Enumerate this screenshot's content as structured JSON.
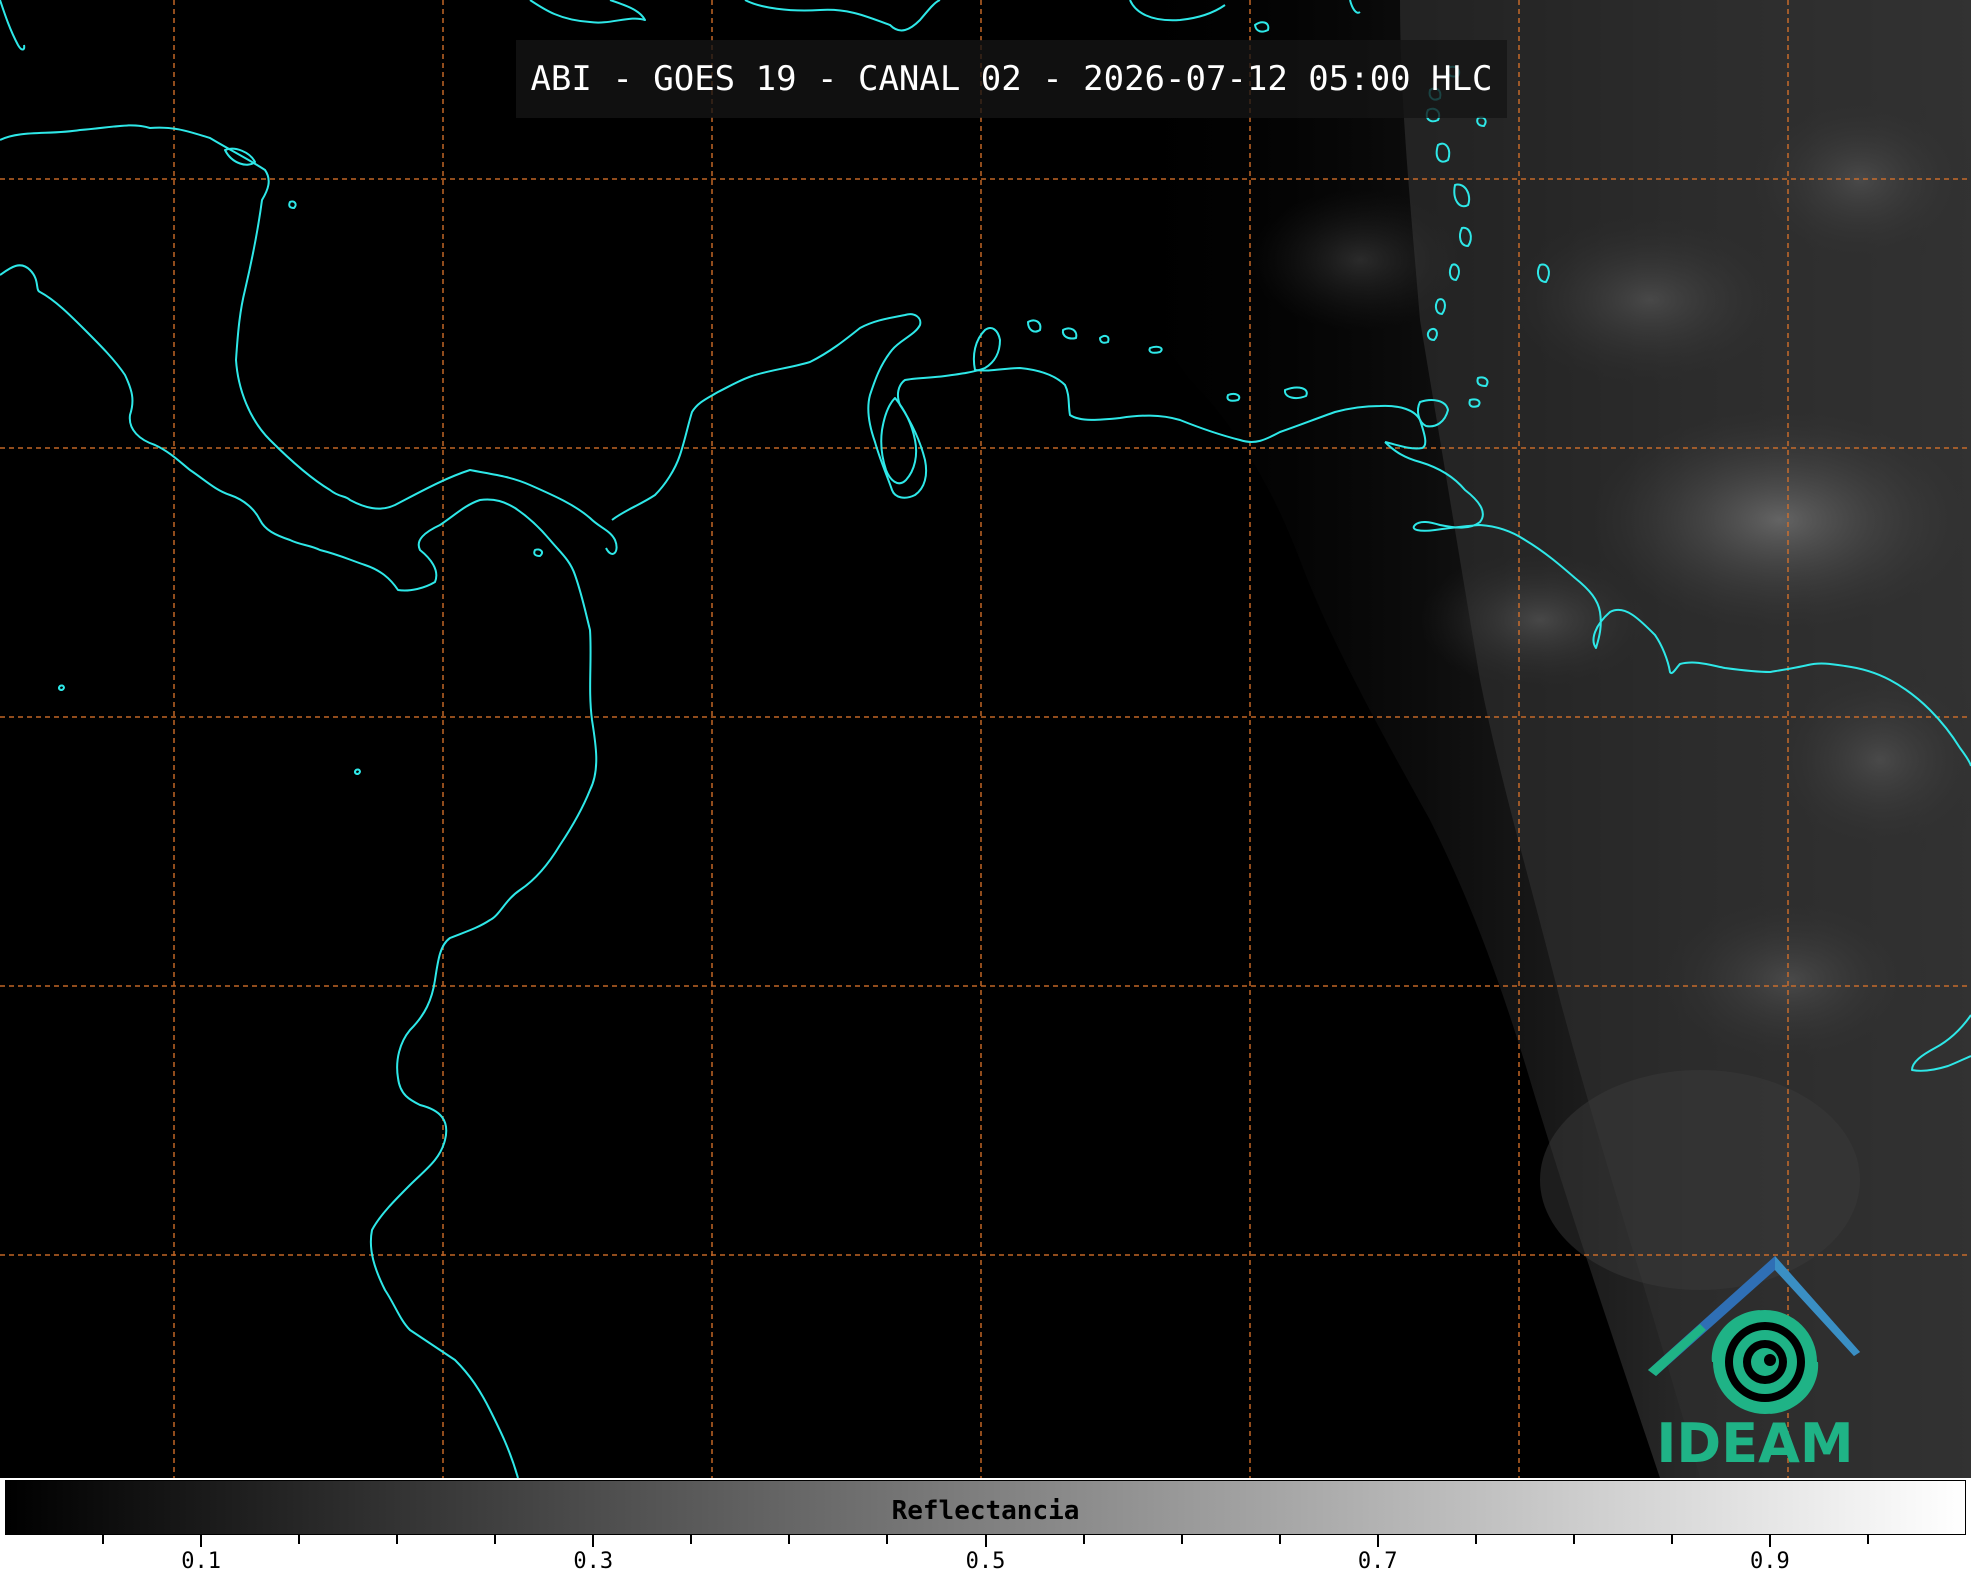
{
  "title": "ABI - GOES 19 - CANAL 02 - 2026-07-12 05:00 HLC",
  "colorbar": {
    "label": "Reflectancia",
    "range": [
      0.0,
      1.0
    ],
    "major_ticks": [
      "0.1",
      "0.3",
      "0.5",
      "0.7",
      "0.9"
    ],
    "major_values": [
      0.1,
      0.3,
      0.5,
      0.7,
      0.9
    ],
    "minor_values": [
      0.05,
      0.15,
      0.2,
      0.25,
      0.35,
      0.4,
      0.45,
      0.55,
      0.6,
      0.65,
      0.75,
      0.8,
      0.85,
      0.95
    ]
  },
  "logo": {
    "text": "IDEAM"
  },
  "colors": {
    "coastline": "#2ee8e8",
    "gridline": "#d6712a",
    "logo_green": "#1fb386",
    "logo_blue": "#2f6fb5",
    "title_text": "#ffffff",
    "map_background": "#000000"
  },
  "map": {
    "grid_style": "dashed",
    "coastlines": "on",
    "cloud_side": "right"
  }
}
